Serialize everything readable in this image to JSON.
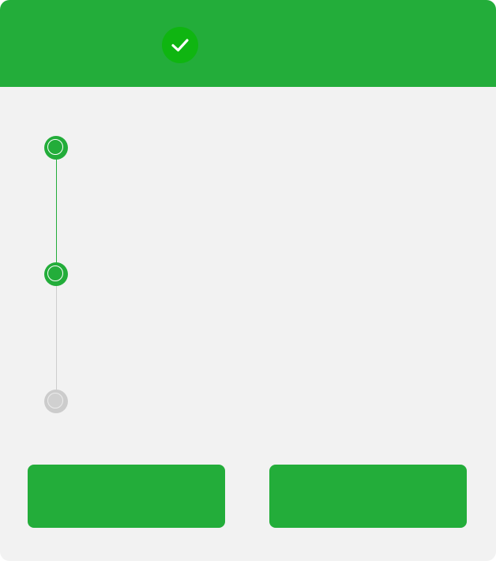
{
  "header": {
    "title": "",
    "icon": "check-circle-icon",
    "colors": {
      "background": "#23ad3a",
      "badge": "#0fb511"
    }
  },
  "steps": [
    {
      "label": "",
      "status": "completed"
    },
    {
      "label": "",
      "status": "current"
    },
    {
      "label": "",
      "status": "pending"
    }
  ],
  "actions": {
    "primary_label": "",
    "secondary_label": ""
  },
  "colors": {
    "accent": "#23ad3a",
    "pending": "#cccccc",
    "card_background": "#f2f2f2"
  }
}
